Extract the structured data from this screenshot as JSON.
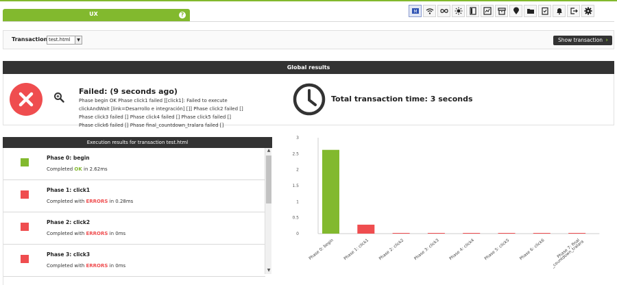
{
  "header": {
    "tab_label": "UX",
    "help_icon": "?",
    "toolbar_icons": [
      "module-icon",
      "wifi-icon",
      "infinity-icon",
      "sun-icon",
      "book-icon",
      "chart-icon",
      "archive-icon",
      "pin-icon",
      "folder-icon",
      "clipboard-icon",
      "bell-icon",
      "logout-icon",
      "gear-icon"
    ]
  },
  "transaction": {
    "label": "Transaction",
    "selected": "test.html",
    "show_button": "Show transaction"
  },
  "global": {
    "title": "Global results",
    "fail_title": "Failed: (9 seconds ago)",
    "fail_text": "Phase begin OK Phase click1 failed [[click1]: Failed to execute clickAndWait [link=Desarrollo e integración] []] Phase click2 failed [] Phase click3 failed [] Phase click4 failed [] Phase click5 failed [] Phase click6 failed [] Phase final_countdown_tralara failed []",
    "total_time": "Total transaction time: 3 seconds"
  },
  "execution": {
    "title": "Execution results for transaction test.html",
    "phases": [
      {
        "title": "Phase 0: begin",
        "prefix": "Completed ",
        "word": "OK",
        "suffix": " in 2.62ms",
        "status": "ok"
      },
      {
        "title": "Phase 1: click1",
        "prefix": "Completed with ",
        "word": "ERRORS",
        "suffix": " in 0.28ms",
        "status": "error"
      },
      {
        "title": "Phase 2: click2",
        "prefix": "Completed with ",
        "word": "ERRORS",
        "suffix": " in 0ms",
        "status": "error"
      },
      {
        "title": "Phase 3: click3",
        "prefix": "Completed with ",
        "word": "ERRORS",
        "suffix": " in 0ms",
        "status": "error"
      }
    ]
  },
  "colors": {
    "ok": "#82b92e",
    "error": "#ef4d4f",
    "dark": "#333333"
  },
  "chart_data": {
    "type": "bar",
    "categories": [
      "Phase 0: begin",
      "Phase 1: click1",
      "Phase 2: click2",
      "Phase 3: click3",
      "Phase 4: click4",
      "Phase 5: click5",
      "Phase 6: click6",
      "Phase 7: final_countdown_tralara"
    ],
    "values": [
      2.62,
      0.28,
      0,
      0,
      0,
      0,
      0,
      0
    ],
    "colors": [
      "#82b92e",
      "#ef4d4f",
      "#ef4d4f",
      "#ef4d4f",
      "#ef4d4f",
      "#ef4d4f",
      "#ef4d4f",
      "#ef4d4f"
    ],
    "ylim": [
      0,
      3
    ],
    "yticks": [
      "0",
      "0.5",
      "1",
      "1.5",
      "2",
      "2.5",
      "3"
    ],
    "grid": false
  }
}
